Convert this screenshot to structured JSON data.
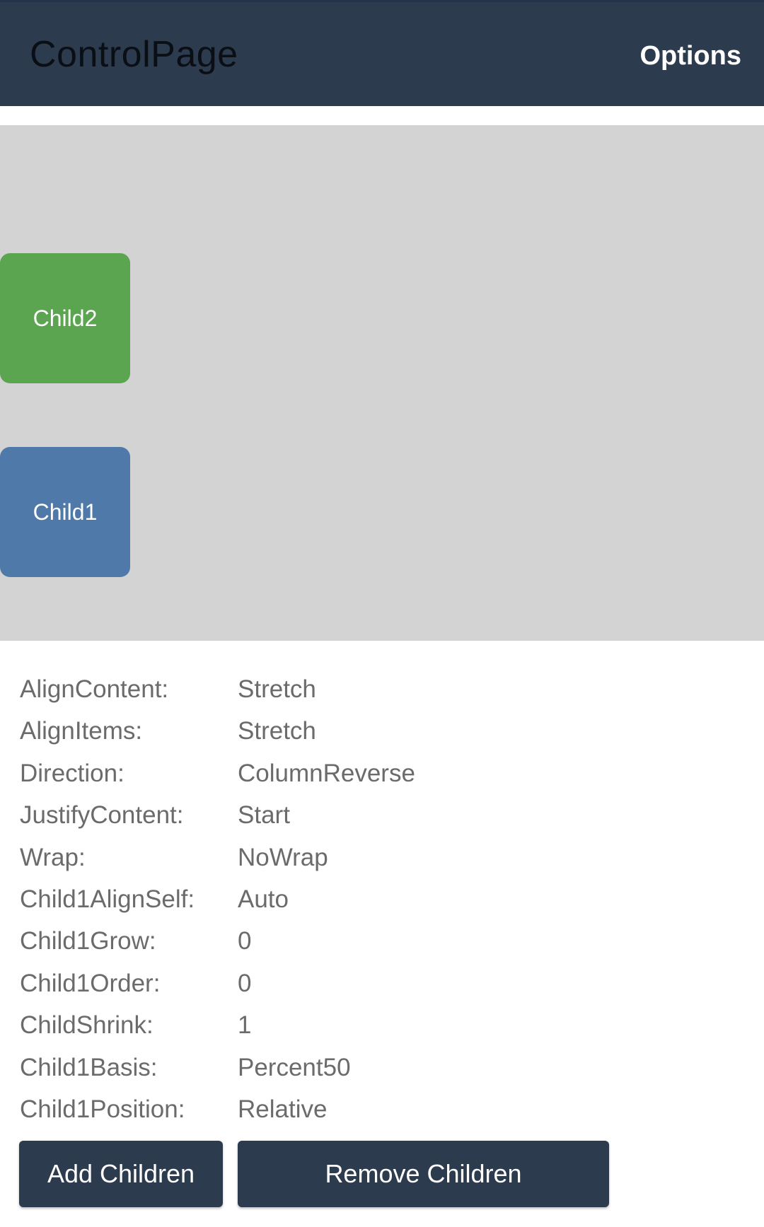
{
  "appbar": {
    "title": "ControlPage",
    "options_label": "Options"
  },
  "flex_area": {
    "children": [
      {
        "label": "Child2",
        "color": "#5ba550"
      },
      {
        "label": "Child1",
        "color": "#4f79a8"
      }
    ]
  },
  "properties": [
    {
      "label": "AlignContent:",
      "value": "Stretch"
    },
    {
      "label": "AlignItems:",
      "value": "Stretch"
    },
    {
      "label": "Direction:",
      "value": "ColumnReverse"
    },
    {
      "label": "JustifyContent:",
      "value": "Start"
    },
    {
      "label": "Wrap:",
      "value": "NoWrap"
    },
    {
      "label": "Child1AlignSelf:",
      "value": "Auto"
    },
    {
      "label": "Child1Grow:",
      "value": "0"
    },
    {
      "label": "Child1Order:",
      "value": "0"
    },
    {
      "label": "ChildShrink:",
      "value": "1"
    },
    {
      "label": "Child1Basis:",
      "value": "Percent50"
    },
    {
      "label": "Child1Position:",
      "value": "Relative"
    }
  ],
  "buttons": {
    "add_label": "Add Children",
    "remove_label": "Remove Children"
  },
  "colors": {
    "appbar": "#2d3b4e",
    "flex_area_bg": "#d3d3d3",
    "button_bg": "#2d3b4e"
  }
}
